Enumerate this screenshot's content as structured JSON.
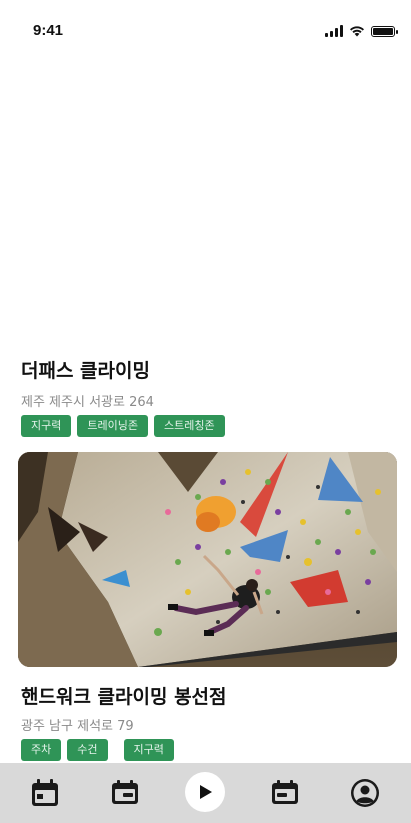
{
  "status_bar": {
    "time": "9:41",
    "battery_level": 1.0
  },
  "gyms": [
    {
      "name": "더패스 클라이밍",
      "address": "제주 제주시 서광로 264",
      "tags": [
        "지구력",
        "트레이닝존",
        "스트레칭존"
      ]
    },
    {
      "name": "핸드워크 클라이밍 봉선점",
      "address": "광주 남구 제석로 79",
      "tags": [
        "주차",
        "수건",
        "지구력"
      ],
      "image": "climbing-wall-photo"
    }
  ],
  "tabbar": {
    "items": [
      "calendar-icon",
      "ticket-icon",
      "play-icon",
      "ticket-icon",
      "profile-icon"
    ]
  },
  "colors": {
    "tag_bg": "#2f9457",
    "tabbar_bg": "#d9d9d9"
  }
}
